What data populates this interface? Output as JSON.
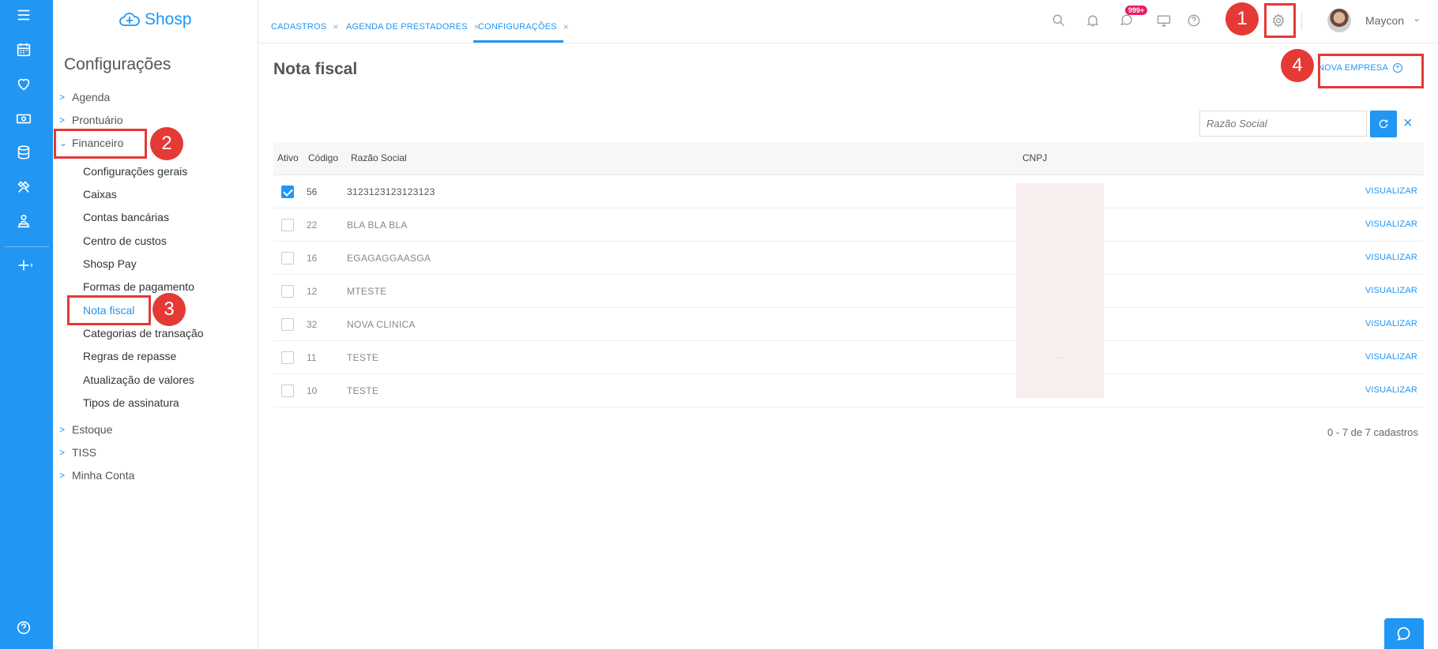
{
  "brand": {
    "name": "Shosp"
  },
  "sidebar": {
    "title": "Configurações",
    "groups": [
      {
        "label": "Agenda",
        "expanded": false
      },
      {
        "label": "Prontuário",
        "expanded": false
      },
      {
        "label": "Financeiro",
        "expanded": true
      },
      {
        "label": "Estoque",
        "expanded": false
      },
      {
        "label": "TISS",
        "expanded": false
      },
      {
        "label": "Minha Conta",
        "expanded": false
      }
    ],
    "financeiro_items": [
      "Configurações gerais",
      "Caixas",
      "Contas bancárias",
      "Centro de custos",
      "Shosp Pay",
      "Formas de pagamento",
      "Nota fiscal",
      "Categorias de transação",
      "Regras de repasse",
      "Atualização de valores",
      "Tipos de assinatura"
    ],
    "active_item": "Nota fiscal"
  },
  "tabs": [
    {
      "label": "CADASTROS"
    },
    {
      "label": "AGENDA DE PRESTADORES"
    },
    {
      "label": "CONFIGURAÇÕES",
      "active": true
    }
  ],
  "topbar": {
    "messages_badge": "999+",
    "user_name": "Maycon"
  },
  "main": {
    "title": "Nota fiscal",
    "new_company_label": "NOVA EMPRESA",
    "search_placeholder": "Razão Social",
    "columns": {
      "active": "Ativo",
      "code": "Código",
      "name": "Razão Social",
      "cnpj": "CNPJ"
    },
    "rows": [
      {
        "active": true,
        "code": "56",
        "name": "3123123123123123",
        "action": "VISUALIZAR"
      },
      {
        "active": false,
        "code": "22",
        "name": "BLA BLA BLA",
        "action": "VISUALIZAR"
      },
      {
        "active": false,
        "code": "16",
        "name": "EGAGAGGAASGA",
        "action": "VISUALIZAR"
      },
      {
        "active": false,
        "code": "12",
        "name": "MTESTE",
        "action": "VISUALIZAR"
      },
      {
        "active": false,
        "code": "32",
        "name": "NOVA CLINICA",
        "action": "VISUALIZAR"
      },
      {
        "active": false,
        "code": "11",
        "name": "TESTE",
        "action": "VISUALIZAR"
      },
      {
        "active": false,
        "code": "10",
        "name": "TESTE",
        "action": "VISUALIZAR"
      }
    ],
    "pager": "0 - 7 de 7 cadastros",
    "cnpj_dots": "..."
  },
  "annotations": [
    "1",
    "2",
    "3",
    "4"
  ],
  "colors": {
    "primary": "#2196f3",
    "annotation": "#e53935",
    "badge": "#e91e63"
  }
}
